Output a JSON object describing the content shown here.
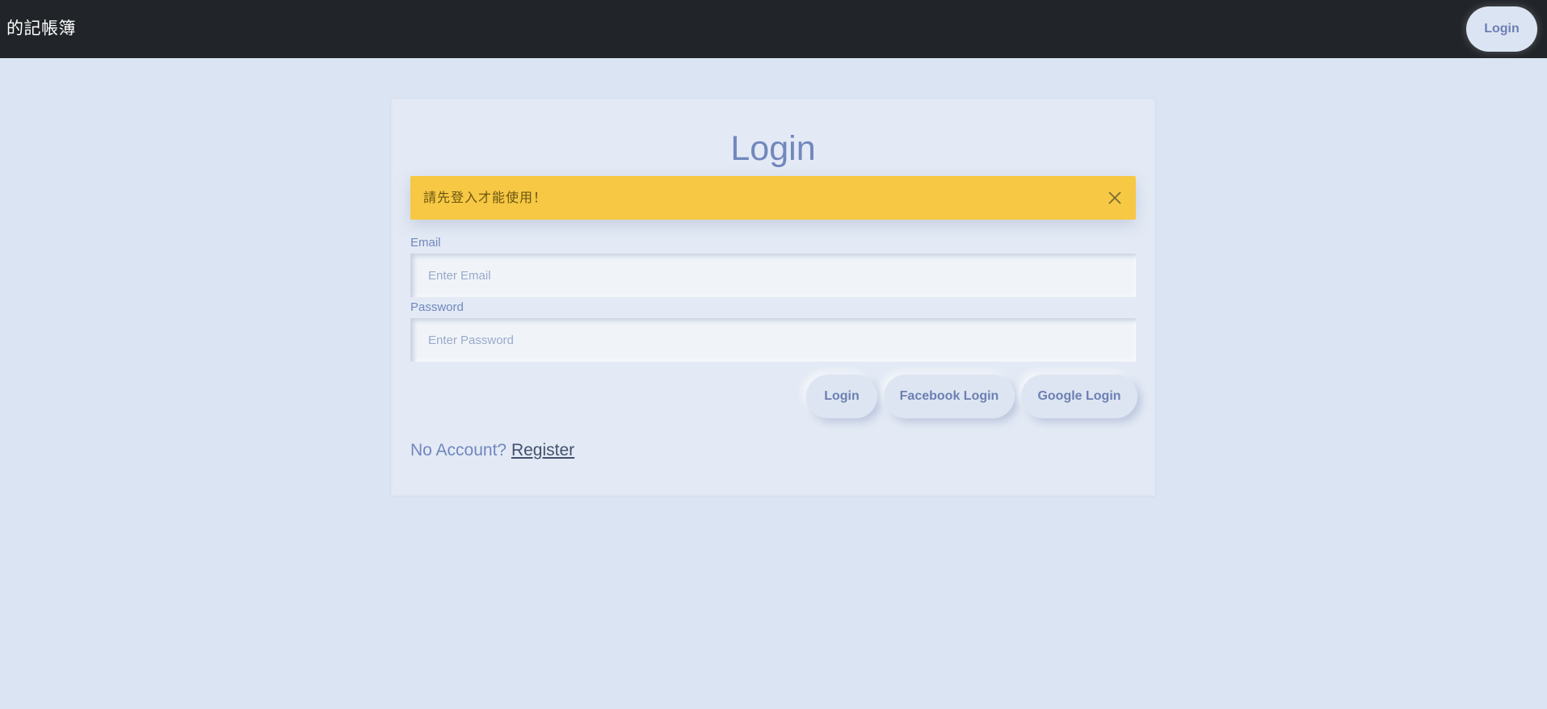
{
  "navbar": {
    "brand": "的記帳簿",
    "login_label": "Login",
    "background": "#212529"
  },
  "card": {
    "title": "Login",
    "alert": {
      "message": "請先登入才能使用！",
      "close_icon": "close-icon",
      "color": "#f6c843"
    },
    "email": {
      "label": "Email",
      "placeholder": "Enter Email",
      "value": ""
    },
    "password": {
      "label": "Password",
      "placeholder": "Enter Password",
      "value": ""
    },
    "buttons": {
      "login": "Login",
      "facebook": "Facebook Login",
      "google": "Google Login"
    },
    "register": {
      "prompt": "No Account?",
      "link": "Register"
    }
  },
  "colors": {
    "page_background": "#dbe4f2",
    "accent_text": "#7187bd"
  }
}
